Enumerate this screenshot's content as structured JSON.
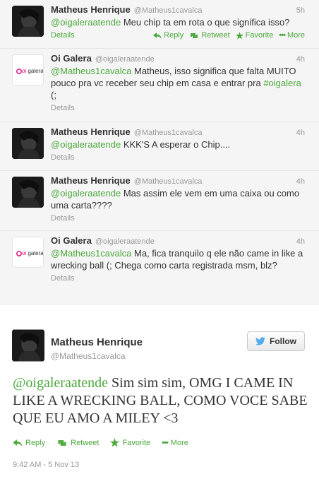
{
  "tweets": [
    {
      "name": "Matheus Henrique",
      "handle": "@Matheus1cavalca",
      "time": "5h",
      "mention": "@oigaleraatende",
      "text": " Meu chip ta em rota o que significa isso?",
      "details": "Details",
      "reply": "Reply",
      "retweet": "Retweet",
      "favorite": "Favorite",
      "more": "More"
    },
    {
      "name": "Oi Galera",
      "handle": "@oigaleraatende",
      "time": "4h",
      "mention": "@Matheus1cavalca",
      "text": " Matheus, isso significa que falta MUITO pouco pra vc receber seu chip em casa e entrar pra ",
      "hashtag": "#oigalera",
      "text2": " (;",
      "details": "Details"
    },
    {
      "name": "Matheus Henrique",
      "handle": "@Matheus1cavalca",
      "time": "4h",
      "mention": "@oigaleraatende",
      "text": " KKK'S A esperar o Chip....",
      "details": "Details"
    },
    {
      "name": "Matheus Henrique",
      "handle": "@Matheus1cavalca",
      "time": "4h",
      "mention": "@oigaleraatende",
      "text": " Mas assim ele vem em uma caixa ou como uma carta????",
      "details": "Details"
    },
    {
      "name": "Oi Galera",
      "handle": "@oigaleraatende",
      "time": "4h",
      "mention": "@Matheus1cavalca",
      "text": " Ma, fica tranquilo q ele não came in like a wrecking ball (; Chega como carta registrada msm, blz?",
      "details": "Details"
    }
  ],
  "main": {
    "name": "Matheus Henrique",
    "handle": "@Matheus1cavalca",
    "follow": "Follow",
    "mention": "@oigaleraatende",
    "text": " Sim sim sim, OMG I CAME IN LIKE A WRECKING BALL, COMO VOCE SABE QUE EU AMO A MILEY <3",
    "reply": "Reply",
    "retweet": "Retweet",
    "favorite": "Favorite",
    "more": "More",
    "timestamp": "9:42 AM - 5 Nov 13"
  },
  "oi_logo_text": "oi galera",
  "colors": {
    "accent": "#4ba83b",
    "twitter_blue": "#55acee"
  }
}
